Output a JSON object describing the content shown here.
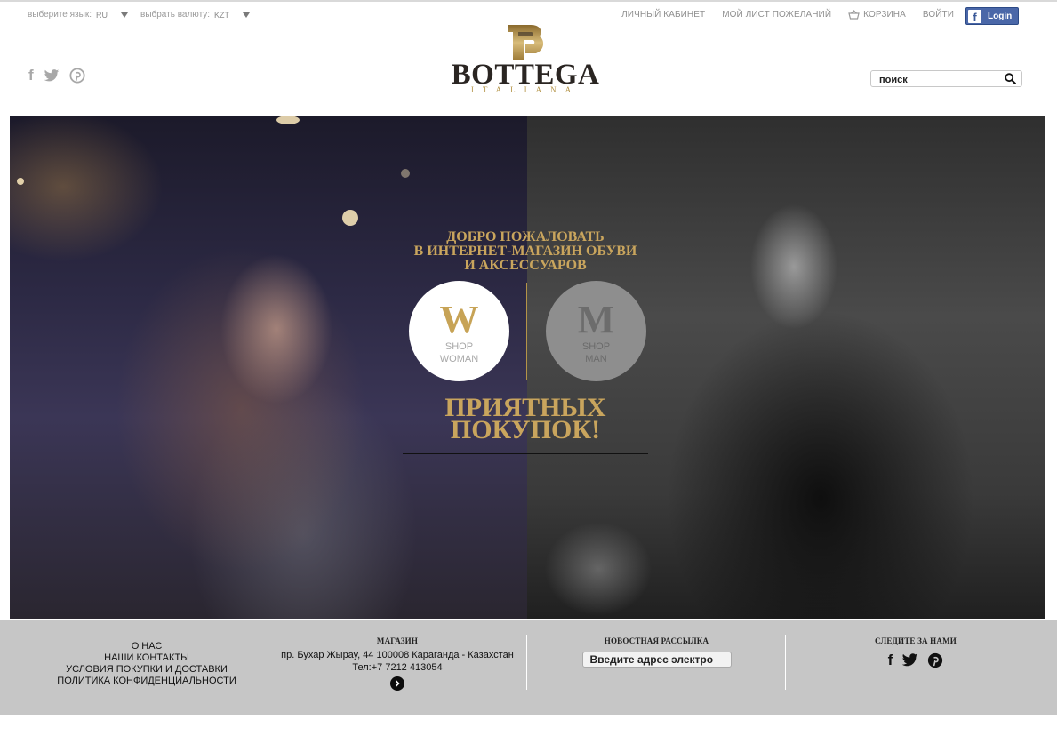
{
  "topbar": {
    "language_label": "выберите язык:",
    "language_value": "RU",
    "currency_label": "выбрать валюту:",
    "currency_value": "KZT",
    "links": [
      "личный кабинет",
      "мой лист пожеланий",
      "корзина",
      "войти"
    ],
    "fb_login": "Login"
  },
  "header": {
    "logo_word": "BOTTEGA",
    "logo_sub": "ITALIANA",
    "social_icons": [
      "facebook-icon",
      "twitter-icon",
      "pinterest-icon"
    ],
    "search_placeholder": "поиск"
  },
  "hero": {
    "welcome": [
      "ДОБРО ПОЖАЛОВАТЬ",
      "В ИНТЕРНЕТ-МАГАЗИН ОБУВИ",
      "И АКСЕССУАРОВ"
    ],
    "woman": {
      "letter": "W",
      "line1": "SHOP",
      "line2": "WOMAN"
    },
    "man": {
      "letter": "M",
      "line1": "SHOP",
      "line2": "MAN"
    },
    "closing": [
      "ПРИЯТНЫХ",
      "ПОКУПОК!"
    ]
  },
  "footer": {
    "links": [
      "О НАС",
      "НАШИ КОНТАКТЫ",
      "УСЛОВИЯ ПОКУПКИ И ДОСТАВКИ",
      "ПОЛИТИКА КОНФИДЕНЦИАЛЬНОСТИ"
    ],
    "store_heading": "МАГАЗИН",
    "store_address": "пр. Бухар Жырау, 44 100008 Караганда - Казахстан",
    "store_phone": "Тел:+7 7212 413054",
    "newsletter_heading": "НОВОСТНАЯ РАССЫЛКА",
    "newsletter_placeholder": "Введите адрес электро",
    "follow_heading": "СЛЕДИТЕ ЗА НАМИ",
    "follow_icons": [
      "facebook-icon",
      "twitter-icon",
      "pinterest-icon"
    ]
  },
  "colors": {
    "gold": "#c9a55d",
    "footer_bg": "#c6c6c6",
    "facebook_blue": "#4a67a8"
  }
}
